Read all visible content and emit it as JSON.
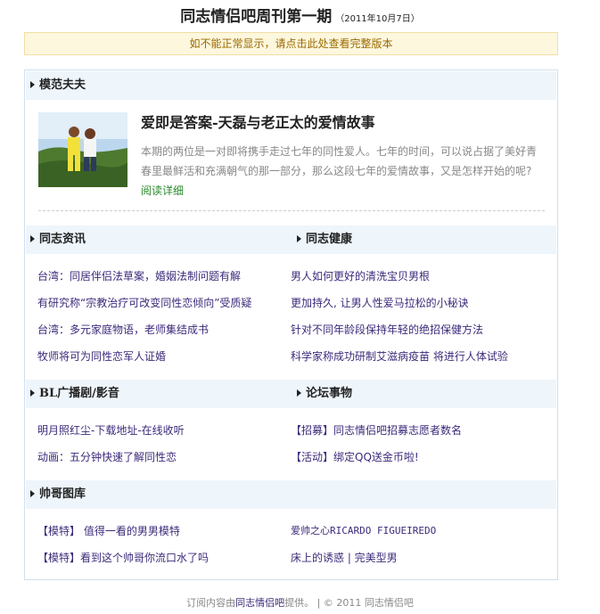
{
  "header": {
    "title": "同志情侣吧周刊第一期",
    "date": "（2011年10月7日）"
  },
  "notice": {
    "text": "如不能正常显示，请点击此处查看完整版本"
  },
  "featured": {
    "section_title": "模范夫夫",
    "image_icon": "photo-couple",
    "title": "爱即是答案-天磊与老正太的爱情故事",
    "desc": "本期的两位是一对即将携手走过七年的同性爱人。七年的时间，可以说占据了美好青春里最鲜活和充满朝气的那一部分，那么这段七年的爱情故事，又是怎样开始的呢?",
    "more": "阅读详细"
  },
  "sections": {
    "news": {
      "title": "同志资讯",
      "items": [
        "台湾：同居伴侣法草案，婚姻法制问题有解",
        "有研究称“宗教治疗可改变同性恋倾向”受质疑",
        "台湾：多元家庭物语，老师集结成书",
        "牧师将可为同性恋军人证婚"
      ]
    },
    "health": {
      "title": "同志健康",
      "items": [
        "男人如何更好的清洗宝贝男根",
        "更加持久, 让男人性爱马拉松的小秘诀",
        "针对不同年龄段保持年轻的绝招保健方法",
        "科学家称成功研制艾滋病疫苗 将进行人体试验"
      ]
    },
    "bl": {
      "title": "BL广播剧/影音",
      "items": [
        "明月照红尘-下载地址-在线收听",
        "动画：五分钟快速了解同性恋"
      ]
    },
    "forum": {
      "title": "论坛事物",
      "items": [
        "【招募】同志情侣吧招募志愿者数名",
        "【活动】绑定QQ送金币啦!"
      ]
    },
    "gallery": {
      "title": "帅哥图库",
      "items": [
        "【模特】 值得一看的男男模特",
        "爱帅之心RICARDO FIGUEIREDO",
        "【模特】看到这个帅哥你流口水了吗",
        "床上的诱惑 | 完美型男"
      ]
    }
  },
  "footer": {
    "prefix": "订阅内容由",
    "brand": "同志情侣吧",
    "suffix": "提供。 | © 2011 同志情侣吧"
  },
  "colors": {
    "link": "#3d2a7a",
    "more_link": "#2a8a2a",
    "notice_bg": "#fdf7dd",
    "section_bg": "#eef5fb",
    "border": "#cfe0ee"
  }
}
